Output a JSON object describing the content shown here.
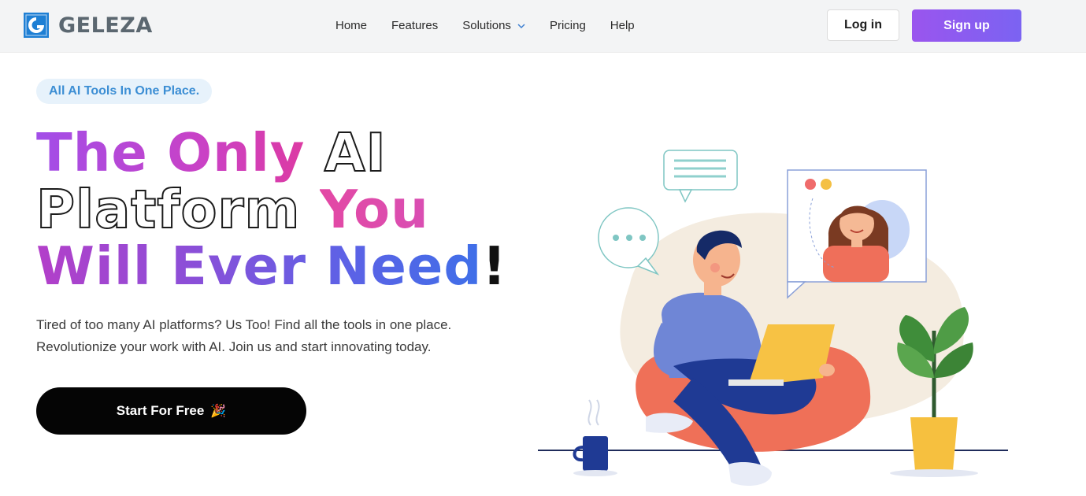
{
  "brand": {
    "name": "GELEZA",
    "accent": "#1e7fd4"
  },
  "nav": {
    "items": [
      {
        "label": "Home"
      },
      {
        "label": "Features"
      },
      {
        "label": "Solutions",
        "has_dropdown": true
      },
      {
        "label": "Pricing"
      },
      {
        "label": "Help"
      }
    ]
  },
  "auth": {
    "login_label": "Log in",
    "signup_label": "Sign up"
  },
  "hero": {
    "badge": "All AI Tools In One Place.",
    "headline": {
      "line1_a": "The Only ",
      "line1_b": "AI",
      "line2_a": "Platform ",
      "line2_b": "You",
      "line3_a": "Will Ever Need",
      "line3_b": "!"
    },
    "subtext_line1": "Tired of too many AI platforms? Us Too! Find all the tools in one place.",
    "subtext_line2": "Revolutionize your work with AI. Join us and start innovating today.",
    "cta_label": "Start For Free",
    "cta_icon": "🎉"
  },
  "colors": {
    "signup_gradient": [
      "#9a55ee",
      "#7b63f2"
    ],
    "badge_bg": "#e7f2fb",
    "badge_text": "#3c8ed4",
    "cta_bg": "#050505"
  }
}
